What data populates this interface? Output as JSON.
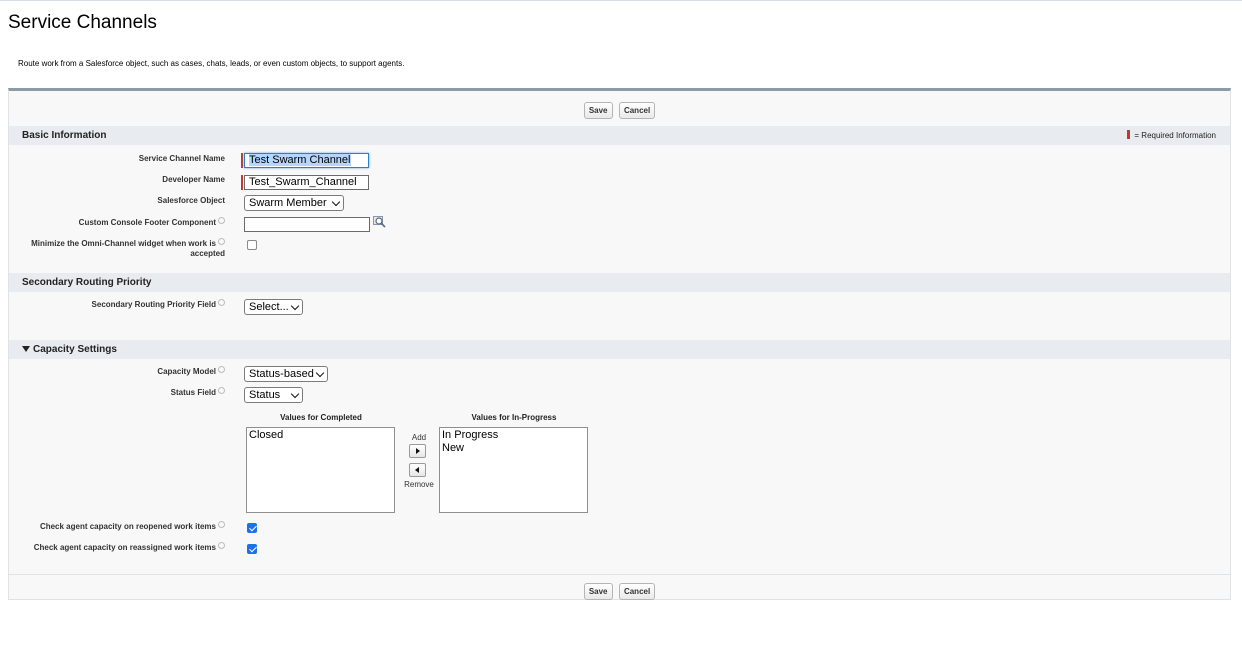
{
  "page": {
    "title": "Service Channels",
    "description": "Route work from a Salesforce object, such as cases, chats, leads, or even custom objects, to support agents."
  },
  "buttons": {
    "save": "Save",
    "cancel": "Cancel"
  },
  "basic_info": {
    "header": "Basic Information",
    "required_legend": "= Required Information",
    "service_channel_name": {
      "label": "Service Channel Name",
      "value": "Test Swarm Channel"
    },
    "developer_name": {
      "label": "Developer Name",
      "value": "Test_Swarm_Channel"
    },
    "salesforce_object": {
      "label": "Salesforce Object",
      "value": "Swarm Member"
    },
    "custom_footer": {
      "label": "Custom Console Footer Component",
      "value": ""
    },
    "minimize_widget": {
      "label_line1": "Minimize the Omni-Channel widget when work is",
      "label_line2": "accepted",
      "checked": false
    }
  },
  "secondary_routing": {
    "header": "Secondary Routing Priority",
    "field": {
      "label": "Secondary Routing Priority Field",
      "value": "Select..."
    }
  },
  "capacity": {
    "header": "Capacity Settings",
    "model": {
      "label": "Capacity Model",
      "value": "Status-based"
    },
    "status_field": {
      "label": "Status Field",
      "value": "Status"
    },
    "completed": {
      "header": "Values for Completed",
      "items": [
        "Closed"
      ]
    },
    "in_progress": {
      "header": "Values for In-Progress",
      "items": [
        "In Progress",
        "New"
      ]
    },
    "add_label": "Add",
    "remove_label": "Remove",
    "reopened": {
      "label": "Check agent capacity on reopened work items",
      "checked": true
    },
    "reassigned": {
      "label": "Check agent capacity on reassigned work items",
      "checked": true
    }
  },
  "colors": {
    "required": "#c23934",
    "checkbox_checked": "#1a73e8",
    "section_bg": "#e8ebef"
  }
}
